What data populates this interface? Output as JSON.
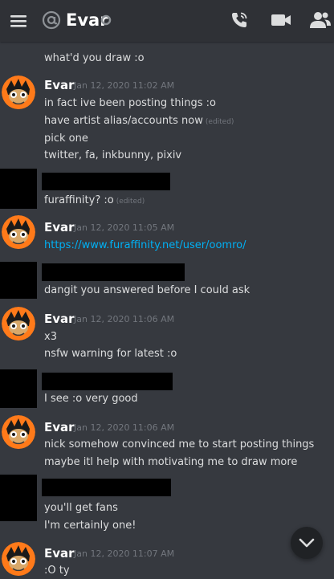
{
  "header": {
    "channel_name": "Evar"
  },
  "messages": {
    "m0": "what'd you draw :o",
    "g1_user": "Evar",
    "g1_time": "Jan 12, 2020 11:02 AM",
    "g1_l1": "in fact ive been posting things :o",
    "g1_l2": "have artist alias/accounts now",
    "g1_l3": "pick one",
    "g1_l4": "twitter, fa, inkbunny, pixiv",
    "r1_l1": "furaffinity? :o",
    "g2_user": "Evar",
    "g2_time": "Jan 12, 2020 11:05 AM",
    "g2_link": "https://www.furaffinity.net/user/oomro/",
    "r2_l1": "dangit you answered before I could ask",
    "g3_user": "Evar",
    "g3_time": "Jan 12, 2020 11:06 AM",
    "g3_l1": "x3",
    "g3_l2": "nsfw warning for latest :o",
    "r3_l1": "I see :o very good",
    "g4_user": "Evar",
    "g4_time": "Jan 12, 2020 11:06 AM",
    "g4_l1": "nick somehow convinced me to start posting things",
    "g4_l2": "maybe itl help with motivating me to draw more",
    "r4_l1": "you'll get fans",
    "r4_l2": "I'm certainly one!",
    "g5_user": "Evar",
    "g5_time": "Jan 12, 2020 11:07 AM",
    "g5_l1": ":O ty"
  },
  "edited_label": "(edited)",
  "icons": {
    "menu": "hamburger-icon",
    "channel": "at-icon",
    "status": "status-icon",
    "call": "phone-icon",
    "video": "video-icon",
    "members": "members-icon",
    "scroll": "chevron-down-icon"
  },
  "colors": {
    "background": "#36393f",
    "header": "#2f3136",
    "link": "#00b0f4",
    "timestamp": "#72767d",
    "text": "#dcddde"
  }
}
